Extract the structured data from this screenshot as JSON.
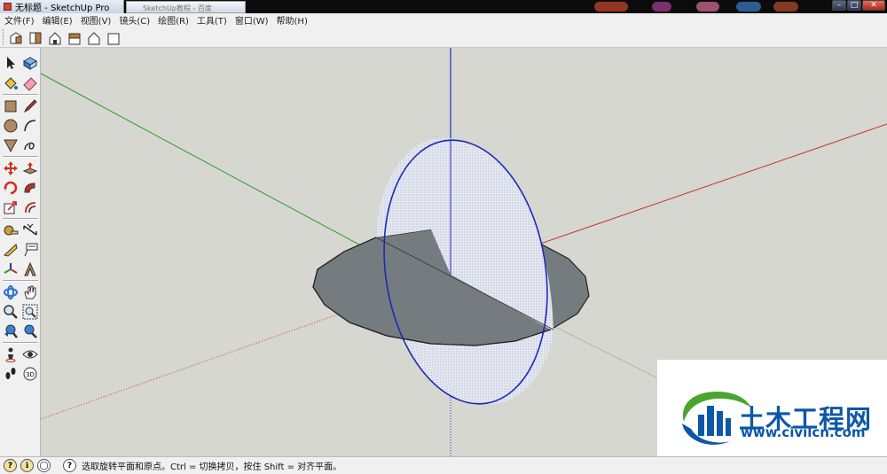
{
  "window": {
    "title": "无标题 - SketchUp Pro",
    "second_tab": "SketchUp教程 - 百度"
  },
  "menus": [
    "文件(F)",
    "编辑(E)",
    "视图(V)",
    "镜头(C)",
    "绘图(R)",
    "工具(T)",
    "窗口(W)",
    "帮助(H)"
  ],
  "top_toolbar": {
    "buttons": [
      "iso-view-icon",
      "top-view-icon",
      "front-view-icon",
      "right-view-icon",
      "back-view-icon",
      "left-view-icon"
    ]
  },
  "left_toolbar": {
    "tools": [
      "select",
      "make-component",
      "paint-bucket",
      "eraser",
      "rectangle",
      "line",
      "circle",
      "arc",
      "polygon",
      "freehand",
      "move",
      "push-pull",
      "rotate",
      "follow-me",
      "scale",
      "offset",
      "tape-measure",
      "dimension",
      "protractor",
      "text",
      "axes",
      "3d-text",
      "orbit",
      "pan",
      "zoom",
      "zoom-window",
      "previous-view",
      "zoom-extents",
      "position-camera",
      "look-around",
      "walk",
      "section-plane"
    ]
  },
  "colors": {
    "viewport_bg": "#d7d7d1",
    "axis_red": "#c03020",
    "axis_green": "#2a9a2a",
    "axis_blue": "#2030c0",
    "disc_face": "#747c80",
    "ellipse_face": "#e6e8f2",
    "ellipse_edge": "#1a2ab8",
    "watermark_blue": "#0d57a8",
    "watermark_green": "#4aa52e"
  },
  "status": {
    "text": "选取旋转平面和原点。Ctrl = 切换拷贝，按住 Shift = 对齐平面。"
  },
  "watermark": {
    "name": "土木工程网",
    "url": "www.civilcn.com"
  }
}
